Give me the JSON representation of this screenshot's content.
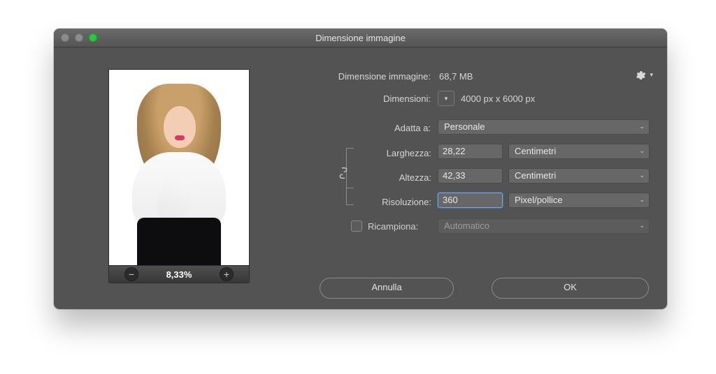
{
  "colors": {
    "accent_focus": "#7aa7d6",
    "panel": "#535353"
  },
  "window": {
    "title": "Dimensione immagine"
  },
  "preview": {
    "zoom": "8,33%"
  },
  "info": {
    "image_size_label": "Dimensione immagine:",
    "image_size_value": "68,7 MB",
    "dimensions_label": "Dimensioni:",
    "dimensions_value": "4000 px x 6000 px"
  },
  "fit": {
    "label": "Adatta a:",
    "value": "Personale"
  },
  "width": {
    "label": "Larghezza:",
    "value": "28,22",
    "unit": "Centimetri"
  },
  "height": {
    "label": "Altezza:",
    "value": "42,33",
    "unit": "Centimetri"
  },
  "resolution": {
    "label": "Risoluzione:",
    "value": "360",
    "unit": "Pixel/pollice"
  },
  "resample": {
    "label": "Ricampiona:",
    "checked": false,
    "method": "Automatico"
  },
  "buttons": {
    "cancel": "Annulla",
    "ok": "OK"
  }
}
